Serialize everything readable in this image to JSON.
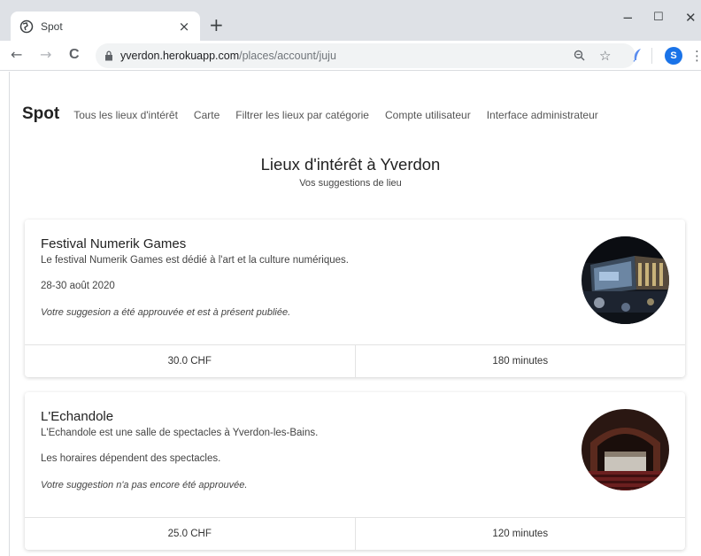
{
  "browser": {
    "tab_title": "Spot",
    "tab_close": "×",
    "new_tab": "+",
    "url_host": "yverdon.herokuapp.com",
    "url_path": "/places/account/juju",
    "profile_initial": "S",
    "window_controls": {
      "minimize": "−",
      "maximize": "☐",
      "close": "✕"
    },
    "nav": {
      "back": "←",
      "forward": "→",
      "reload": "C"
    }
  },
  "navbar": {
    "brand": "Spot",
    "links": [
      "Tous les lieux d'intérêt",
      "Carte",
      "Filtrer les lieux par catégorie",
      "Compte utilisateur",
      "Interface administrateur"
    ]
  },
  "header": {
    "title": "Lieux d'intérêt à Yverdon",
    "subtitle": "Vos suggestions de lieu"
  },
  "cards": [
    {
      "title": "Festival Numerik Games",
      "description": "Le festival Numerik Games est dédié à l'art et la culture numériques.",
      "date": "28-30 août 2020",
      "status": "Votre suggesion a été approuvée et est à présent publiée.",
      "price": "30.0 CHF",
      "duration": "180 minutes"
    },
    {
      "title": "L'Echandole",
      "description": "L'Echandole est une salle de spectacles à Yverdon-les-Bains.",
      "date": "Les horaires dépendent des spectacles.",
      "status": "Votre suggestion n'a pas encore été approuvée.",
      "price": "25.0 CHF",
      "duration": "120 minutes"
    }
  ],
  "colors": {
    "chrome_bg": "#dee1e6",
    "omnibox_bg": "#f1f3f4",
    "profile_blue": "#1a73e8"
  }
}
